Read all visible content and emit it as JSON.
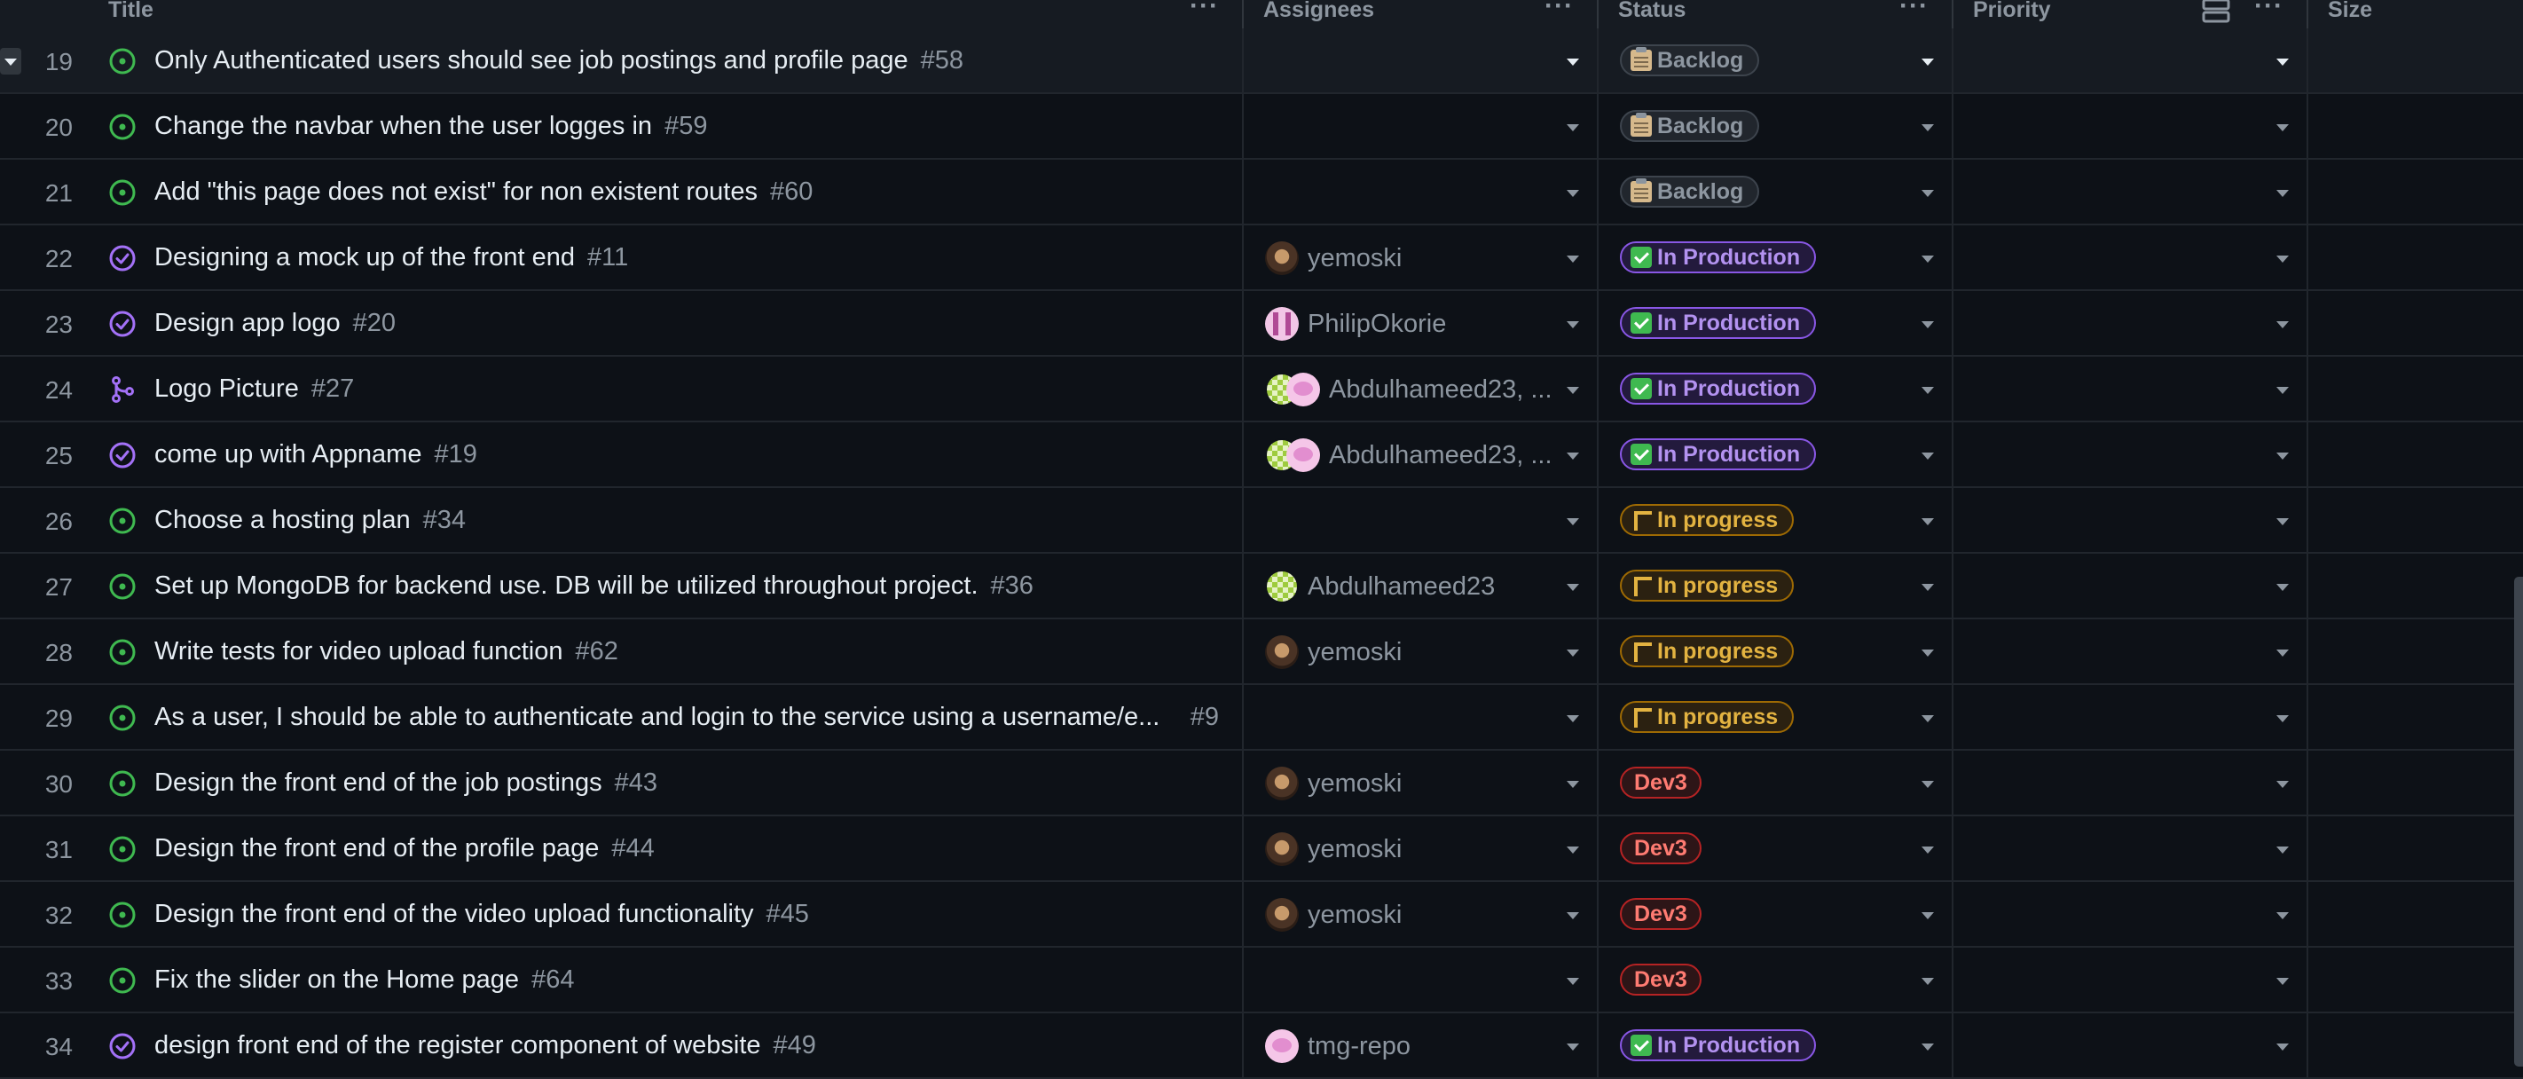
{
  "columns": {
    "title": "Title",
    "assignees": "Assignees",
    "status": "Status",
    "priority": "Priority",
    "size": "Size"
  },
  "colors": {
    "open_issue": "#3fb950",
    "closed_issue": "#a371f7",
    "pull_request": "#a371f7",
    "in_production": "#b392f0",
    "in_progress": "#e3b341",
    "dev3": "#ff7b72",
    "backlog": "#8d96a0"
  },
  "rows": [
    {
      "n": "19",
      "state": "open",
      "icon": "issue-open-icon",
      "title": "Only Authenticated users should see job postings and profile page",
      "num": "#58",
      "assignees": [],
      "assignee_label": "",
      "status": "Backlog",
      "status_kind": "backlog"
    },
    {
      "n": "20",
      "state": "open",
      "icon": "issue-open-icon",
      "title": "Change the navbar when the user logges in",
      "num": "#59",
      "assignees": [],
      "assignee_label": "",
      "status": "Backlog",
      "status_kind": "backlog"
    },
    {
      "n": "21",
      "state": "open",
      "icon": "issue-open-icon",
      "title": "Add \"this page does not exist\" for non existent routes",
      "num": "#60",
      "assignees": [],
      "assignee_label": "",
      "status": "Backlog",
      "status_kind": "backlog"
    },
    {
      "n": "22",
      "state": "closed",
      "icon": "issue-closed-icon",
      "title": "Designing a mock up of the front end",
      "num": "#11",
      "assignees": [
        "yem"
      ],
      "assignee_label": "yemoski",
      "status": "In Production",
      "status_kind": "prod"
    },
    {
      "n": "23",
      "state": "closed",
      "icon": "issue-closed-icon",
      "title": "Design app logo",
      "num": "#20",
      "assignees": [
        "phil"
      ],
      "assignee_label": "PhilipOkorie",
      "status": "In Production",
      "status_kind": "prod"
    },
    {
      "n": "24",
      "state": "merged",
      "icon": "pull-request-merged-icon",
      "title": "Logo Picture",
      "num": "#27",
      "assignees": [
        "abd",
        "tmg"
      ],
      "assignee_label": "Abdulhameed23, ...",
      "status": "In Production",
      "status_kind": "prod"
    },
    {
      "n": "25",
      "state": "closed",
      "icon": "issue-closed-icon",
      "title": "come up with Appname",
      "num": "#19",
      "assignees": [
        "abd",
        "tmg"
      ],
      "assignee_label": "Abdulhameed23, ...",
      "status": "In Production",
      "status_kind": "prod"
    },
    {
      "n": "26",
      "state": "open",
      "icon": "issue-open-icon",
      "title": "Choose a hosting plan",
      "num": "#34",
      "assignees": [],
      "assignee_label": "",
      "status": "In progress",
      "status_kind": "prog"
    },
    {
      "n": "27",
      "state": "open",
      "icon": "issue-open-icon",
      "title": "Set up MongoDB for backend use. DB will be utilized throughout project.",
      "num": "#36",
      "assignees": [
        "abd"
      ],
      "assignee_label": "Abdulhameed23",
      "status": "In progress",
      "status_kind": "prog"
    },
    {
      "n": "28",
      "state": "open",
      "icon": "issue-open-icon",
      "title": "Write tests for video upload function",
      "num": "#62",
      "assignees": [
        "yem"
      ],
      "assignee_label": "yemoski",
      "status": "In progress",
      "status_kind": "prog"
    },
    {
      "n": "29",
      "state": "open",
      "icon": "issue-open-icon",
      "title": "As a user, I should be able to authenticate and login to the service using a username/e...",
      "num": "#9",
      "assignees": [],
      "assignee_label": "",
      "status": "In progress",
      "status_kind": "prog",
      "num_right": true
    },
    {
      "n": "30",
      "state": "open",
      "icon": "issue-open-icon",
      "title": "Design the front end of the job postings",
      "num": "#43",
      "assignees": [
        "yem"
      ],
      "assignee_label": "yemoski",
      "status": "Dev3",
      "status_kind": "dev"
    },
    {
      "n": "31",
      "state": "open",
      "icon": "issue-open-icon",
      "title": "Design the front end of the profile page",
      "num": "#44",
      "assignees": [
        "yem"
      ],
      "assignee_label": "yemoski",
      "status": "Dev3",
      "status_kind": "dev"
    },
    {
      "n": "32",
      "state": "open",
      "icon": "issue-open-icon",
      "title": "Design the front end of the video upload functionality",
      "num": "#45",
      "assignees": [
        "yem"
      ],
      "assignee_label": "yemoski",
      "status": "Dev3",
      "status_kind": "dev"
    },
    {
      "n": "33",
      "state": "open",
      "icon": "issue-open-icon",
      "title": "Fix the slider on the Home page",
      "num": "#64",
      "assignees": [],
      "assignee_label": "",
      "status": "Dev3",
      "status_kind": "dev"
    },
    {
      "n": "34",
      "state": "closed",
      "icon": "issue-closed-icon",
      "title": "design front end of the register component of website",
      "num": "#49",
      "assignees": [
        "tmg"
      ],
      "assignee_label": "tmg-repo",
      "status": "In Production",
      "status_kind": "prod"
    }
  ]
}
